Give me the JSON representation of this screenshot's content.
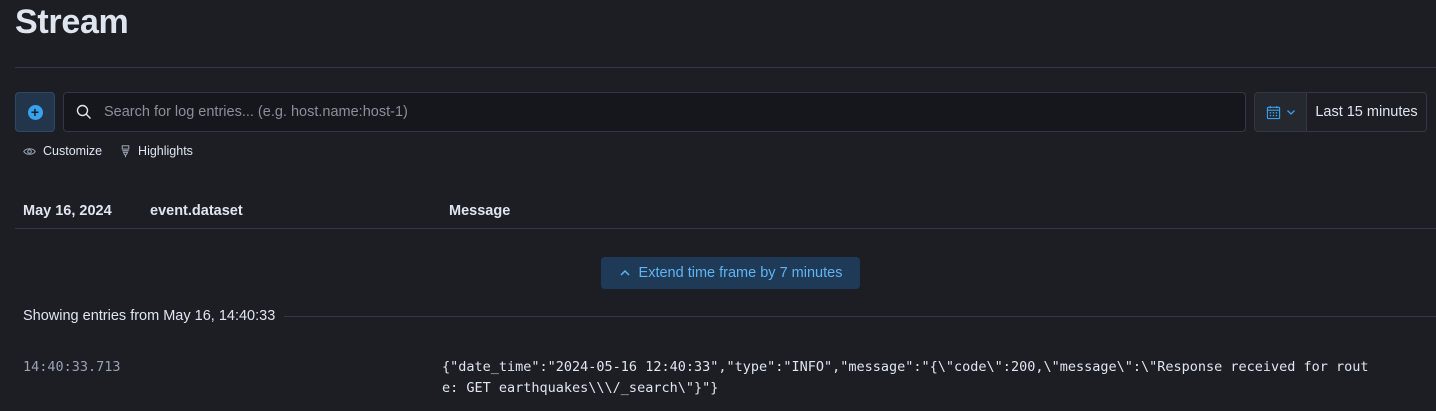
{
  "page": {
    "title": "Stream"
  },
  "search": {
    "placeholder": "Search for log entries... (e.g. host.name:host-1)",
    "value": ""
  },
  "date_picker": {
    "range_label": "Last 15 minutes"
  },
  "controls": {
    "customize_label": "Customize",
    "highlights_label": "Highlights"
  },
  "columns": {
    "date": "May 16, 2024",
    "dataset": "event.dataset",
    "message": "Message"
  },
  "extend_button": {
    "label": "Extend time frame by 7 minutes"
  },
  "showing": {
    "text": "Showing entries from May 16, 14:40:33"
  },
  "log_entries": [
    {
      "time": "14:40:33.713",
      "dataset": "",
      "message": "{\"date_time\":\"2024-05-16 12:40:33\",\"type\":\"INFO\",\"message\":\"{\\\"code\\\":200,\\\"message\\\":\\\"Response received for route: GET earthquakes\\\\\\/_search\\\"}\"}"
    }
  ],
  "colors": {
    "accent": "#36a2ef",
    "background": "#1d1e24",
    "border": "#343741"
  }
}
